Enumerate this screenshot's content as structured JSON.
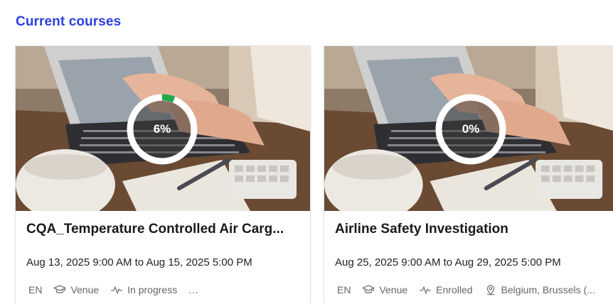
{
  "section": {
    "title": "Current courses"
  },
  "courses": [
    {
      "title": "CQA_Temperature Controlled Air Carg...",
      "progress_label": "6%",
      "progress": 0.06,
      "dates": "Aug 13, 2025 9:00 AM to Aug 15, 2025 5:00 PM",
      "language": "EN",
      "type_icon": "graduation-cap-icon",
      "type": "Venue",
      "status_icon": "activity-pulse-icon",
      "status": "In progress",
      "more": "...",
      "location": ""
    },
    {
      "title": "Airline Safety Investigation",
      "progress_label": "0%",
      "progress": 0,
      "dates": "Aug 25, 2025 9:00 AM to Aug 29, 2025 5:00 PM",
      "language": "EN",
      "type_icon": "graduation-cap-icon",
      "type": "Venue",
      "status_icon": "activity-pulse-icon",
      "status": "Enrolled",
      "location_icon": "map-pin-icon",
      "location": "Belgium, Brussels (...",
      "more": ""
    }
  ],
  "colors": {
    "title_accent": "#2b3fe0",
    "progress_fill": "#1fa84a",
    "progress_track": "#ffffff"
  }
}
